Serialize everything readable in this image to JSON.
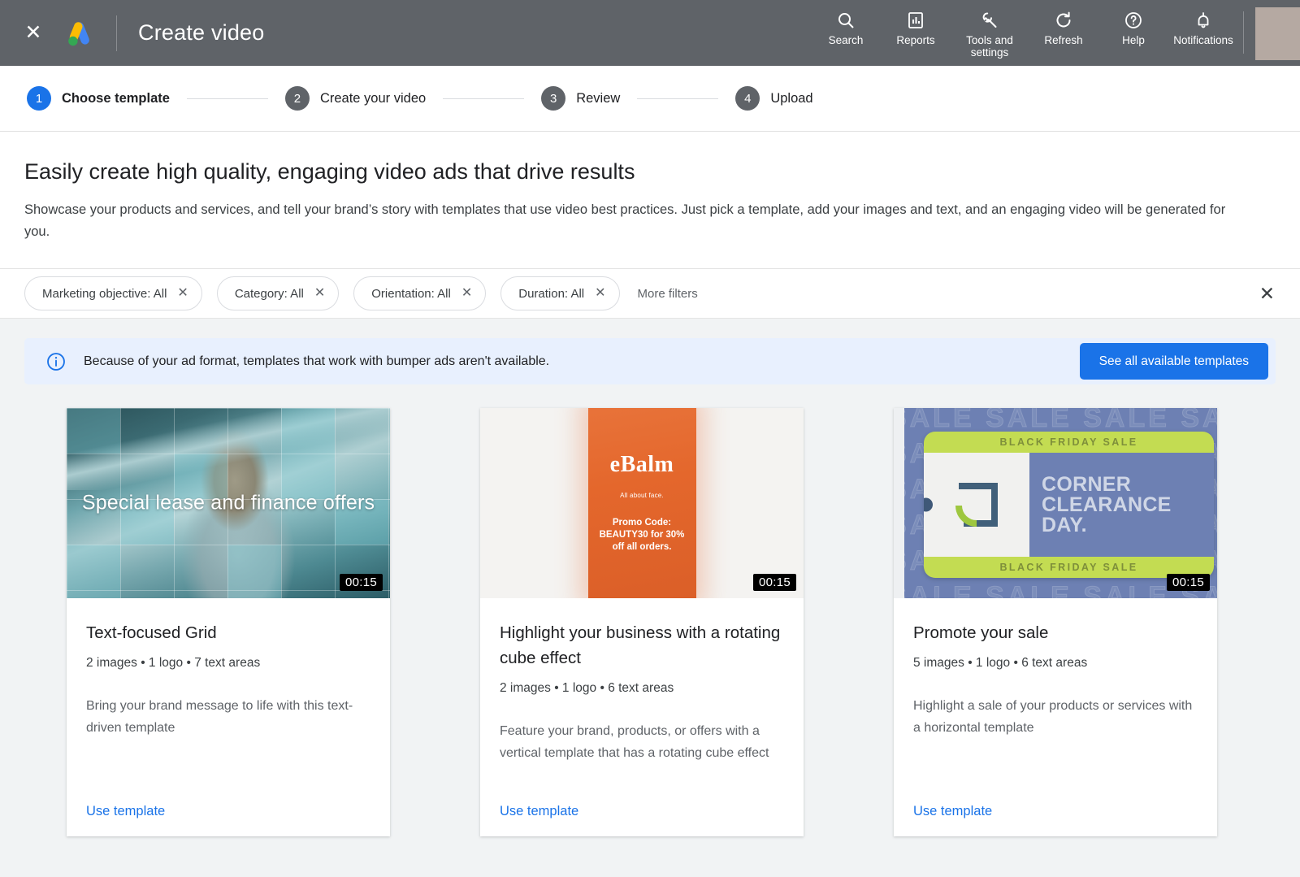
{
  "appbar": {
    "close_label": "✕",
    "title": "Create video",
    "logo_name": "google-ads-logo",
    "actions": [
      {
        "id": "search",
        "label": "Search",
        "icon": "search-icon"
      },
      {
        "id": "reports",
        "label": "Reports",
        "icon": "reports-icon"
      },
      {
        "id": "tools",
        "label": "Tools and settings",
        "icon": "wrench-icon"
      },
      {
        "id": "refresh",
        "label": "Refresh",
        "icon": "refresh-icon"
      },
      {
        "id": "help",
        "label": "Help",
        "icon": "help-icon"
      },
      {
        "id": "notifications",
        "label": "Notifications",
        "icon": "bell-icon"
      }
    ]
  },
  "stepper": {
    "steps": [
      {
        "num": "1",
        "label": "Choose template",
        "active": true
      },
      {
        "num": "2",
        "label": "Create your video",
        "active": false
      },
      {
        "num": "3",
        "label": "Review",
        "active": false
      },
      {
        "num": "4",
        "label": "Upload",
        "active": false
      }
    ]
  },
  "intro": {
    "heading": "Easily create high quality, engaging video ads that drive results",
    "description": "Showcase your products and services, and tell your brand’s story with templates that use video best practices. Just pick a template, add your images and text, and an engaging video will be generated for you."
  },
  "filters": {
    "chips": [
      {
        "label": "Marketing objective: All",
        "remove": "✕"
      },
      {
        "label": "Category: All",
        "remove": "✕"
      },
      {
        "label": "Orientation: All",
        "remove": "✕"
      },
      {
        "label": "Duration: All",
        "remove": "✕"
      }
    ],
    "more_label": "More filters",
    "close_label": "✕"
  },
  "notice": {
    "icon": "info-icon",
    "message": "Because of your ad format, templates that work with bumper ads aren't available.",
    "cta_label": "See all available templates",
    "cta_color": "#1a73e8",
    "background": "#e8f0fe"
  },
  "templates": [
    {
      "id": "text-focused-grid",
      "title": "Text-focused Grid",
      "meta": "2 images • 1 logo • 7 text areas",
      "description": "Bring your brand message to life with this text-driven template",
      "action_label": "Use template",
      "duration": "00:15",
      "thumb_caption": "Special lease and finance offers"
    },
    {
      "id": "rotating-cube",
      "title": "Highlight your business with a rotating cube effect",
      "meta": "2 images • 1 logo • 6 text areas",
      "description": "Feature your brand, products, or offers with a vertical template that has a rotating cube effect",
      "action_label": "Use template",
      "duration": "00:15",
      "thumb_brand": "eBalm",
      "thumb_tagline": "All about face.",
      "thumb_promo": "Promo Code: BEAUTY30 for 30% off all orders."
    },
    {
      "id": "promote-your-sale",
      "title": "Promote your sale",
      "meta": "5 images • 1 logo • 6 text areas",
      "description": "Highlight a sale of your products or services with a horizontal template",
      "action_label": "Use template",
      "duration": "00:15",
      "thumb_band_top": "BLACK FRIDAY SALE",
      "thumb_band_bottom": "BLACK FRIDAY SALE",
      "thumb_line1": "CORNER",
      "thumb_line2": "CLEARANCE",
      "thumb_line3": "DAY.",
      "thumb_watermark": "SALE SALE SALE SALE SA"
    }
  ]
}
